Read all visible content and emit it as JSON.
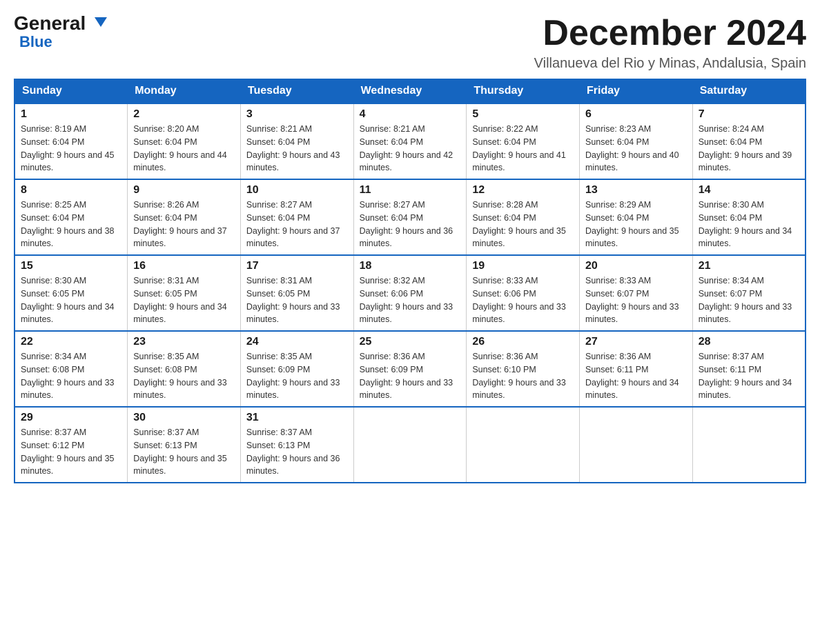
{
  "header": {
    "logo_general": "General",
    "logo_blue": "Blue",
    "month_title": "December 2024",
    "subtitle": "Villanueva del Rio y Minas, Andalusia, Spain"
  },
  "weekdays": [
    "Sunday",
    "Monday",
    "Tuesday",
    "Wednesday",
    "Thursday",
    "Friday",
    "Saturday"
  ],
  "weeks": [
    [
      {
        "day": "1",
        "sunrise": "8:19 AM",
        "sunset": "6:04 PM",
        "daylight": "9 hours and 45 minutes."
      },
      {
        "day": "2",
        "sunrise": "8:20 AM",
        "sunset": "6:04 PM",
        "daylight": "9 hours and 44 minutes."
      },
      {
        "day": "3",
        "sunrise": "8:21 AM",
        "sunset": "6:04 PM",
        "daylight": "9 hours and 43 minutes."
      },
      {
        "day": "4",
        "sunrise": "8:21 AM",
        "sunset": "6:04 PM",
        "daylight": "9 hours and 42 minutes."
      },
      {
        "day": "5",
        "sunrise": "8:22 AM",
        "sunset": "6:04 PM",
        "daylight": "9 hours and 41 minutes."
      },
      {
        "day": "6",
        "sunrise": "8:23 AM",
        "sunset": "6:04 PM",
        "daylight": "9 hours and 40 minutes."
      },
      {
        "day": "7",
        "sunrise": "8:24 AM",
        "sunset": "6:04 PM",
        "daylight": "9 hours and 39 minutes."
      }
    ],
    [
      {
        "day": "8",
        "sunrise": "8:25 AM",
        "sunset": "6:04 PM",
        "daylight": "9 hours and 38 minutes."
      },
      {
        "day": "9",
        "sunrise": "8:26 AM",
        "sunset": "6:04 PM",
        "daylight": "9 hours and 37 minutes."
      },
      {
        "day": "10",
        "sunrise": "8:27 AM",
        "sunset": "6:04 PM",
        "daylight": "9 hours and 37 minutes."
      },
      {
        "day": "11",
        "sunrise": "8:27 AM",
        "sunset": "6:04 PM",
        "daylight": "9 hours and 36 minutes."
      },
      {
        "day": "12",
        "sunrise": "8:28 AM",
        "sunset": "6:04 PM",
        "daylight": "9 hours and 35 minutes."
      },
      {
        "day": "13",
        "sunrise": "8:29 AM",
        "sunset": "6:04 PM",
        "daylight": "9 hours and 35 minutes."
      },
      {
        "day": "14",
        "sunrise": "8:30 AM",
        "sunset": "6:04 PM",
        "daylight": "9 hours and 34 minutes."
      }
    ],
    [
      {
        "day": "15",
        "sunrise": "8:30 AM",
        "sunset": "6:05 PM",
        "daylight": "9 hours and 34 minutes."
      },
      {
        "day": "16",
        "sunrise": "8:31 AM",
        "sunset": "6:05 PM",
        "daylight": "9 hours and 34 minutes."
      },
      {
        "day": "17",
        "sunrise": "8:31 AM",
        "sunset": "6:05 PM",
        "daylight": "9 hours and 33 minutes."
      },
      {
        "day": "18",
        "sunrise": "8:32 AM",
        "sunset": "6:06 PM",
        "daylight": "9 hours and 33 minutes."
      },
      {
        "day": "19",
        "sunrise": "8:33 AM",
        "sunset": "6:06 PM",
        "daylight": "9 hours and 33 minutes."
      },
      {
        "day": "20",
        "sunrise": "8:33 AM",
        "sunset": "6:07 PM",
        "daylight": "9 hours and 33 minutes."
      },
      {
        "day": "21",
        "sunrise": "8:34 AM",
        "sunset": "6:07 PM",
        "daylight": "9 hours and 33 minutes."
      }
    ],
    [
      {
        "day": "22",
        "sunrise": "8:34 AM",
        "sunset": "6:08 PM",
        "daylight": "9 hours and 33 minutes."
      },
      {
        "day": "23",
        "sunrise": "8:35 AM",
        "sunset": "6:08 PM",
        "daylight": "9 hours and 33 minutes."
      },
      {
        "day": "24",
        "sunrise": "8:35 AM",
        "sunset": "6:09 PM",
        "daylight": "9 hours and 33 minutes."
      },
      {
        "day": "25",
        "sunrise": "8:36 AM",
        "sunset": "6:09 PM",
        "daylight": "9 hours and 33 minutes."
      },
      {
        "day": "26",
        "sunrise": "8:36 AM",
        "sunset": "6:10 PM",
        "daylight": "9 hours and 33 minutes."
      },
      {
        "day": "27",
        "sunrise": "8:36 AM",
        "sunset": "6:11 PM",
        "daylight": "9 hours and 34 minutes."
      },
      {
        "day": "28",
        "sunrise": "8:37 AM",
        "sunset": "6:11 PM",
        "daylight": "9 hours and 34 minutes."
      }
    ],
    [
      {
        "day": "29",
        "sunrise": "8:37 AM",
        "sunset": "6:12 PM",
        "daylight": "9 hours and 35 minutes."
      },
      {
        "day": "30",
        "sunrise": "8:37 AM",
        "sunset": "6:13 PM",
        "daylight": "9 hours and 35 minutes."
      },
      {
        "day": "31",
        "sunrise": "8:37 AM",
        "sunset": "6:13 PM",
        "daylight": "9 hours and 36 minutes."
      },
      null,
      null,
      null,
      null
    ]
  ]
}
